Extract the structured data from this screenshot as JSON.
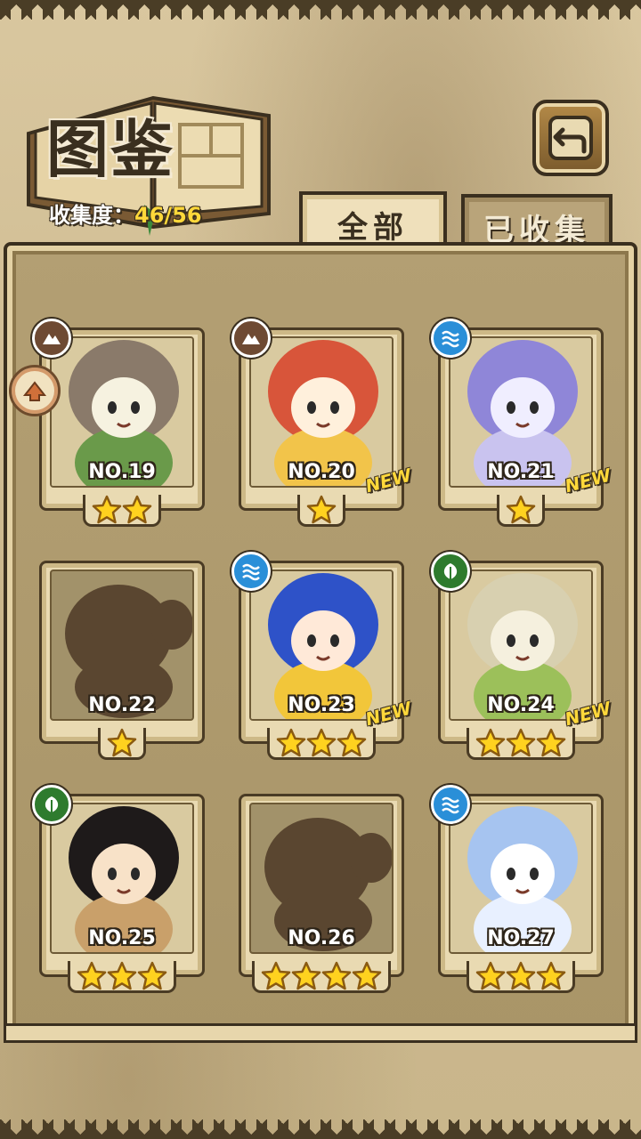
{
  "header": {
    "title": "图鉴",
    "collection_label": "收集度：",
    "collection_value": "46/56"
  },
  "tabs": {
    "all": "全部",
    "collected": "已收集"
  },
  "cards": [
    {
      "no": "NO.19",
      "stars": 2,
      "element": "earth",
      "new": false,
      "unlocked": true,
      "colors": [
        "#8a7a6a",
        "#6a9a4a",
        "#f6f2e0"
      ]
    },
    {
      "no": "NO.20",
      "stars": 1,
      "element": "earth",
      "new": true,
      "unlocked": true,
      "colors": [
        "#d8553a",
        "#f2c44a",
        "#fff0dc"
      ]
    },
    {
      "no": "NO.21",
      "stars": 1,
      "element": "water",
      "new": true,
      "unlocked": true,
      "colors": [
        "#8f86d8",
        "#c9c3ef",
        "#f0eeff"
      ]
    },
    {
      "no": "NO.22",
      "stars": 1,
      "element": "",
      "new": false,
      "unlocked": false,
      "colors": [
        "#5a4630",
        "#5a4630",
        "#5a4630"
      ]
    },
    {
      "no": "NO.23",
      "stars": 3,
      "element": "water",
      "new": true,
      "unlocked": true,
      "colors": [
        "#2e52c8",
        "#f2c63a",
        "#ffe9d8"
      ]
    },
    {
      "no": "NO.24",
      "stars": 3,
      "element": "grass",
      "new": true,
      "unlocked": true,
      "colors": [
        "#d8d0b0",
        "#9cc05a",
        "#f5f0de"
      ]
    },
    {
      "no": "NO.25",
      "stars": 3,
      "element": "grass",
      "new": false,
      "unlocked": true,
      "colors": [
        "#1e1a1a",
        "#c9a06a",
        "#f8e2c8"
      ]
    },
    {
      "no": "NO.26",
      "stars": 4,
      "element": "",
      "new": false,
      "unlocked": false,
      "colors": [
        "#5a4630",
        "#5a4630",
        "#5a4630"
      ]
    },
    {
      "no": "NO.27",
      "stars": 3,
      "element": "water",
      "new": false,
      "unlocked": true,
      "colors": [
        "#a6c4f0",
        "#e8f0ff",
        "#ffffff"
      ]
    }
  ],
  "labels": {
    "new": "NEW"
  },
  "colors": {
    "accent_yellow": "#ffd83a",
    "frame_dark": "#3a2f1f",
    "parchment": "#e9dab2"
  }
}
